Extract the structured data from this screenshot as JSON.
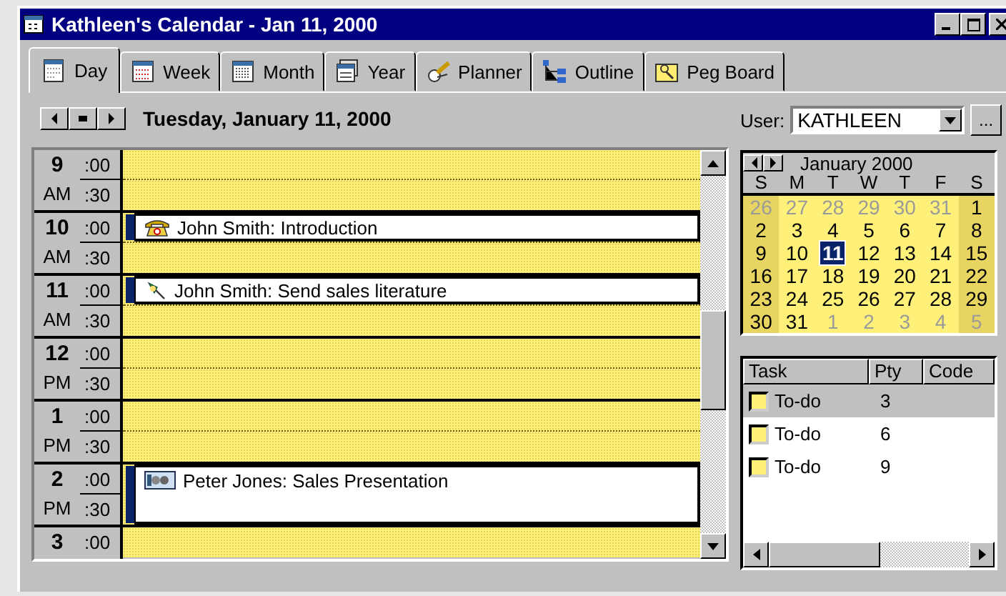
{
  "window": {
    "title": "Kathleen's Calendar - Jan 11, 2000"
  },
  "tabs": [
    {
      "label": "Day",
      "selected": true
    },
    {
      "label": "Week",
      "selected": false
    },
    {
      "label": "Month",
      "selected": false
    },
    {
      "label": "Year",
      "selected": false
    },
    {
      "label": "Planner",
      "selected": false
    },
    {
      "label": "Outline",
      "selected": false
    },
    {
      "label": "Peg Board",
      "selected": false
    }
  ],
  "date_heading": "Tuesday, January 11, 2000",
  "user": {
    "label": "User:",
    "value": "KATHLEEN",
    "browse_button": "..."
  },
  "day_view": {
    "hours": [
      {
        "hour": "9",
        "period": "AM",
        "slots": [
          {
            "minute": ":00"
          },
          {
            "minute": ":30"
          }
        ]
      },
      {
        "hour": "10",
        "period": "AM",
        "slots": [
          {
            "minute": ":00",
            "appointment": {
              "title": "John Smith: Introduction",
              "kind": "call"
            }
          },
          {
            "minute": ":30"
          }
        ]
      },
      {
        "hour": "11",
        "period": "AM",
        "slots": [
          {
            "minute": ":00",
            "appointment": {
              "title": "John Smith: Send sales literature",
              "kind": "task"
            }
          },
          {
            "minute": ":30"
          }
        ]
      },
      {
        "hour": "12",
        "period": "PM",
        "slots": [
          {
            "minute": ":00"
          },
          {
            "minute": ":30"
          }
        ]
      },
      {
        "hour": "1",
        "period": "PM",
        "slots": [
          {
            "minute": ":00"
          },
          {
            "minute": ":30"
          }
        ]
      },
      {
        "hour": "2",
        "period": "PM",
        "slots": [
          {
            "minute": ":00"
          },
          {
            "minute": ":30"
          }
        ],
        "appointment": {
          "title": "Peter Jones: Sales Presentation",
          "kind": "meeting"
        }
      },
      {
        "hour": "3",
        "slots": [
          {
            "minute": ":00"
          }
        ]
      }
    ]
  },
  "mini_calendar": {
    "month": "January 2000",
    "weekdays": [
      "S",
      "M",
      "T",
      "W",
      "T",
      "F",
      "S"
    ],
    "weeks": [
      [
        {
          "day": "26",
          "muted": true,
          "selected": false
        },
        {
          "day": "27",
          "muted": true,
          "selected": false
        },
        {
          "day": "28",
          "muted": true,
          "selected": false
        },
        {
          "day": "29",
          "muted": true,
          "selected": false
        },
        {
          "day": "30",
          "muted": true,
          "selected": false
        },
        {
          "day": "31",
          "muted": true,
          "selected": false
        },
        {
          "day": "1",
          "muted": false,
          "selected": false
        }
      ],
      [
        {
          "day": "2",
          "muted": false,
          "selected": false
        },
        {
          "day": "3",
          "muted": false,
          "selected": false
        },
        {
          "day": "4",
          "muted": false,
          "selected": false
        },
        {
          "day": "5",
          "muted": false,
          "selected": false
        },
        {
          "day": "6",
          "muted": false,
          "selected": false
        },
        {
          "day": "7",
          "muted": false,
          "selected": false
        },
        {
          "day": "8",
          "muted": false,
          "selected": false
        }
      ],
      [
        {
          "day": "9",
          "muted": false,
          "selected": false
        },
        {
          "day": "10",
          "muted": false,
          "selected": false
        },
        {
          "day": "11",
          "muted": false,
          "selected": true
        },
        {
          "day": "12",
          "muted": false,
          "selected": false
        },
        {
          "day": "13",
          "muted": false,
          "selected": false
        },
        {
          "day": "14",
          "muted": false,
          "selected": false
        },
        {
          "day": "15",
          "muted": false,
          "selected": false
        }
      ],
      [
        {
          "day": "16",
          "muted": false,
          "selected": false
        },
        {
          "day": "17",
          "muted": false,
          "selected": false
        },
        {
          "day": "18",
          "muted": false,
          "selected": false
        },
        {
          "day": "19",
          "muted": false,
          "selected": false
        },
        {
          "day": "20",
          "muted": false,
          "selected": false
        },
        {
          "day": "21",
          "muted": false,
          "selected": false
        },
        {
          "day": "22",
          "muted": false,
          "selected": false
        }
      ],
      [
        {
          "day": "23",
          "muted": false,
          "selected": false
        },
        {
          "day": "24",
          "muted": false,
          "selected": false
        },
        {
          "day": "25",
          "muted": false,
          "selected": false
        },
        {
          "day": "26",
          "muted": false,
          "selected": false
        },
        {
          "day": "27",
          "muted": false,
          "selected": false
        },
        {
          "day": "28",
          "muted": false,
          "selected": false
        },
        {
          "day": "29",
          "muted": false,
          "selected": false
        }
      ],
      [
        {
          "day": "30",
          "muted": false,
          "selected": false
        },
        {
          "day": "31",
          "muted": false,
          "selected": false
        },
        {
          "day": "1",
          "muted": true,
          "selected": false
        },
        {
          "day": "2",
          "muted": true,
          "selected": false
        },
        {
          "day": "3",
          "muted": true,
          "selected": false
        },
        {
          "day": "4",
          "muted": true,
          "selected": false
        },
        {
          "day": "5",
          "muted": true,
          "selected": false
        }
      ]
    ]
  },
  "task_list": {
    "columns": [
      "Task",
      "Pty",
      "Code"
    ],
    "rows": [
      {
        "task": "To-do",
        "priority": "3",
        "checked": false,
        "selected": true
      },
      {
        "task": "To-do",
        "priority": "6",
        "checked": false,
        "selected": false
      },
      {
        "task": "To-do",
        "priority": "9",
        "checked": false,
        "selected": false
      }
    ]
  }
}
